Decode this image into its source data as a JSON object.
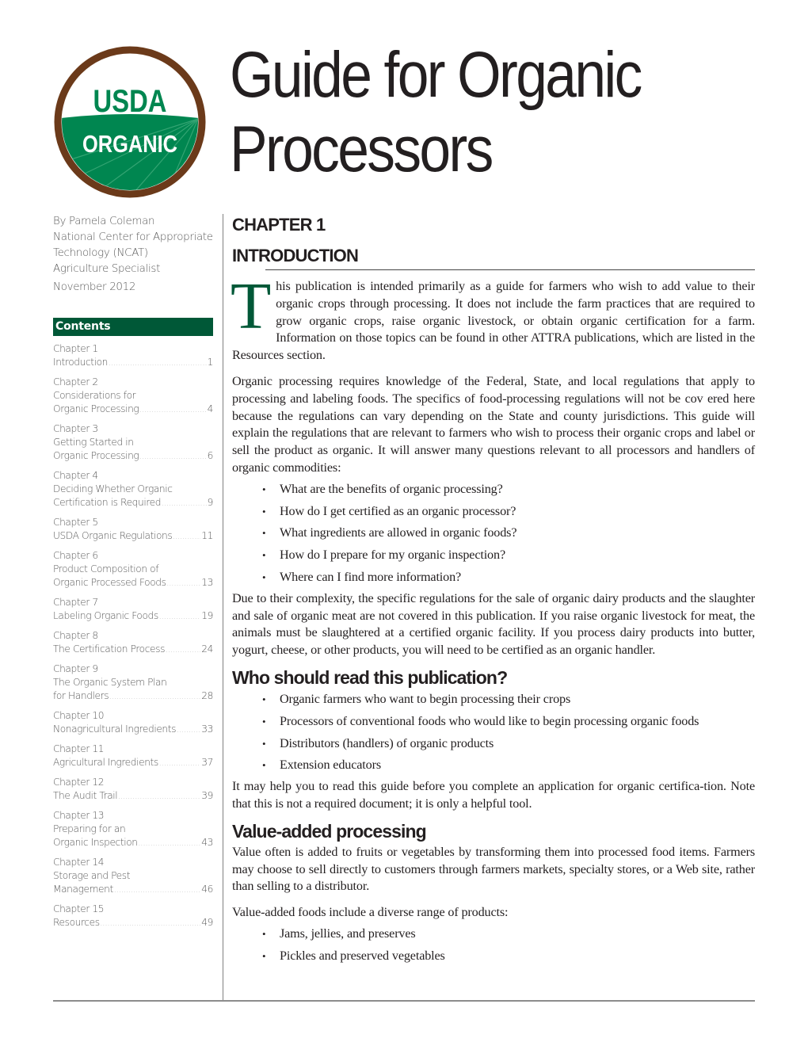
{
  "logo": {
    "top_text": "USDA",
    "band_text": "ORGANIC",
    "colors": {
      "ring": "#6b3a1a",
      "green": "#008650",
      "white": "#ffffff"
    }
  },
  "title": {
    "line1": "Guide for Organic",
    "line2": "Processors"
  },
  "byline": {
    "author": "By Pamela Coleman",
    "org_line1": "National Center for Appropriate",
    "org_line2": "Technology (NCAT)",
    "role": "Agriculture Specialist",
    "date": "November 2012"
  },
  "contents": {
    "heading": "Contents",
    "items": [
      {
        "chapter": "Chapter 1",
        "lines": [],
        "last": "Introduction",
        "page": "1"
      },
      {
        "chapter": "Chapter 2",
        "lines": [
          "Considerations for"
        ],
        "last": "Organic Processing",
        "page": "4"
      },
      {
        "chapter": "Chapter 3",
        "lines": [
          "Getting Started in"
        ],
        "last": "Organic Processing",
        "page": "6"
      },
      {
        "chapter": "Chapter 4",
        "lines": [
          "Deciding Whether Organic"
        ],
        "last": "Certification is Required",
        "page": "9"
      },
      {
        "chapter": "Chapter 5",
        "lines": [],
        "last": "USDA Organic Regulations",
        "page": "11"
      },
      {
        "chapter": "Chapter 6",
        "lines": [
          "Product Composition of"
        ],
        "last": "Organic Processed Foods",
        "page": "13"
      },
      {
        "chapter": "Chapter 7",
        "lines": [],
        "last": "Labeling Organic Foods",
        "page": "19"
      },
      {
        "chapter": "Chapter 8",
        "lines": [],
        "last": "The Certification Process",
        "page": "24"
      },
      {
        "chapter": "Chapter 9",
        "lines": [
          "The Organic System Plan"
        ],
        "last": "for Handlers",
        "page": "28"
      },
      {
        "chapter": "Chapter 10",
        "lines": [],
        "last": "Nonagricultural Ingredients",
        "page": "33"
      },
      {
        "chapter": "Chapter 11",
        "lines": [],
        "last": "Agricultural Ingredients",
        "page": "37"
      },
      {
        "chapter": "Chapter 12",
        "lines": [],
        "last": "The Audit Trail",
        "page": "39"
      },
      {
        "chapter": "Chapter 13",
        "lines": [
          "Preparing for an"
        ],
        "last": "Organic Inspection",
        "page": "43"
      },
      {
        "chapter": "Chapter 14",
        "lines": [
          "Storage and Pest"
        ],
        "last": "Management",
        "page": "46"
      },
      {
        "chapter": "Chapter 15",
        "lines": [],
        "last": "Resources",
        "page": "49"
      }
    ]
  },
  "main": {
    "chapter_label": "CHAPTER 1",
    "chapter_title": "INTRODUCTION",
    "intro": {
      "dropcap": "T",
      "text": "his publication is intended primarily as a guide for farmers who wish to add value to their organic crops through processing. It does not include the farm practices that are required to grow organic crops, raise organic livestock, or obtain organic certification for a farm. Information on those topics can be found in other ATTRA publications, which are listed in the Resources section."
    },
    "p2": "Organic processing requires knowledge of the Federal, State, and local regulations that apply to processing and labeling foods. The specifics of food-processing regulations will not be cov  ered here because the regulations can vary depending on the State and county jurisdictions. This guide will explain the regulations that are relevant to farmers who wish to process their organic crops and label or sell the product as organic. It will answer many questions relevant to all processors and handlers of organic commodities:",
    "questions": [
      "What are the benefits of organic processing?",
      "How do I get certified as an organic processor?",
      "What ingredients are allowed in organic foods?",
      "How do I prepare for my organic inspection?",
      "Where can I find more information?"
    ],
    "p3": "Due to their complexity, the specific regulations for the sale of organic dairy products and the slaughter and sale of organic meat are not covered in this publication. If you raise organic livestock for meat, the animals must be slaughtered at a certified organic facility. If you process dairy products into butter, yogurt, cheese, or other products, you will need to be certified as an organic handler.",
    "who_heading": "Who should read this publication?",
    "who_list": [
      "Organic farmers who want to begin processing their crops",
      "Processors of conventional foods who would like to begin processing organic foods",
      "Distributors (handlers) of organic products",
      "Extension educators"
    ],
    "p4": "It may help you to read this guide before you complete an application for organic certifica-tion. Note that this is not a required document; it is only a helpful tool.",
    "value_heading": "Value-added processing",
    "p5": "Value often is added to fruits or vegetables by transforming them into processed food items. Farmers may choose to sell directly to customers through farmers markets, specialty stores, or a Web site, rather than selling to a distributor.",
    "p6": "Value-added foods include a diverse range of products:",
    "value_list": [
      "Jams, jellies, and preserves",
      "Pickles and preserved vegetables"
    ]
  },
  "bullet_glyph": "•",
  "accent_color": "#005837"
}
